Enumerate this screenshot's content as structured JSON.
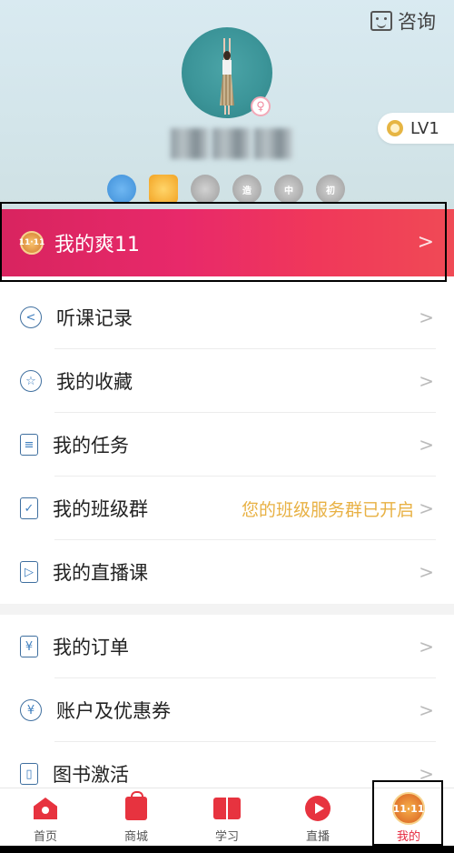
{
  "header": {
    "consult_label": "咨询",
    "level_label": "LV1",
    "medals": [
      "",
      "",
      "",
      "造",
      "中",
      "初"
    ]
  },
  "promo": {
    "icon_text": "11·11",
    "label": "我的爽11",
    "chevron": ">"
  },
  "menu_group1": [
    {
      "label": "听课记录",
      "icon": "back-circle-icon",
      "icon_glyph": "<"
    },
    {
      "label": "我的收藏",
      "icon": "star-icon",
      "icon_glyph": "☆"
    },
    {
      "label": "我的任务",
      "icon": "clipboard-icon",
      "icon_glyph": "≡"
    },
    {
      "label": "我的班级群",
      "icon": "calendar-check-icon",
      "icon_glyph": "✓",
      "note": "您的班级服务群已开启"
    },
    {
      "label": "我的直播课",
      "icon": "tv-play-icon",
      "icon_glyph": "▷"
    }
  ],
  "menu_group2": [
    {
      "label": "我的订单",
      "icon": "order-icon",
      "icon_glyph": "¥"
    },
    {
      "label": "账户及优惠券",
      "icon": "coin-icon",
      "icon_glyph": "¥"
    },
    {
      "label": "图书激活",
      "icon": "book-icon",
      "icon_glyph": "▯"
    }
  ],
  "chevron": ">",
  "tabbar": [
    {
      "label": "首页",
      "icon": "home-icon"
    },
    {
      "label": "商城",
      "icon": "shopping-bag-icon"
    },
    {
      "label": "学习",
      "icon": "book-open-icon"
    },
    {
      "label": "直播",
      "icon": "play-circle-icon"
    },
    {
      "label": "我的",
      "icon": "me-1111-icon",
      "icon_text": "11·11",
      "active": true
    }
  ],
  "colors": {
    "accent": "#e5283d",
    "promo_start": "#d8245f",
    "promo_end": "#f04a55",
    "note": "#e8b144"
  }
}
